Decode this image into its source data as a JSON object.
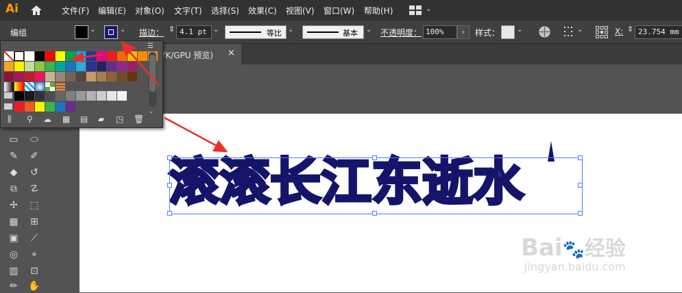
{
  "app": {
    "logo": "Ai"
  },
  "menu": [
    "文件(F)",
    "编辑(E)",
    "对象(O)",
    "文字(T)",
    "选择(S)",
    "效果(C)",
    "视图(V)",
    "窗口(W)",
    "帮助(H)"
  ],
  "control": {
    "mode_label": "编组",
    "stroke_label": "描边：",
    "stroke_value": "4.1 pt",
    "profile_label": "等比",
    "brush_label": "基本",
    "opacity_label": "不透明度：",
    "opacity_value": "100%",
    "style_label": "样式：",
    "x_label": "X:",
    "x_value": "23.754 mm"
  },
  "document": {
    "tab_title": "YK/GPU 预览)",
    "close_glyph": "×"
  },
  "art": {
    "text": "滚滚长江东逝水",
    "fill_color": "#3434b4",
    "stroke_color": "#14146a"
  },
  "swatches": {
    "row1": [
      "#ffffff",
      "#000000",
      "#ff0000",
      "#ffff00",
      "#00a650",
      "#00aeef",
      "#2e3192",
      "#ec008c",
      "#ed1c24",
      "#ff6600",
      "#fcb900",
      "#ff8c00",
      "#f7941d"
    ],
    "row2": [
      "#f6a623",
      "#fff200",
      "#c4df9b",
      "#8dc63f",
      "#39b54a",
      "#00a99d",
      "#1b75bc",
      "#29abe2",
      "#2e3192",
      "#262262",
      "#662d91",
      "#92278f",
      "#9e1f63"
    ],
    "row3": [
      "#8a1538",
      "#a3195b",
      "#be1e2d",
      "#ed145b",
      "#c7b299",
      "#998675",
      "#736357",
      "#534741",
      "#c69c6d",
      "#a67c52",
      "#8c6239",
      "#754c24",
      "#603813"
    ],
    "gray_row": [
      "#000000",
      "#1a1a1a",
      "#333333",
      "#4d4d4d",
      "#666666",
      "#808080",
      "#999999",
      "#b3b3b3",
      "#cccccc",
      "#e6e6e6",
      "#f2f2f2"
    ],
    "bottom_row": [
      "#ed1c24",
      "#f15a24",
      "#fff200",
      "#39b54a",
      "#1b75bc",
      "#662d91"
    ]
  },
  "watermark": {
    "brand": "Bai",
    "brand_suffix": "经验",
    "url": "jingyan.baidu.com"
  }
}
